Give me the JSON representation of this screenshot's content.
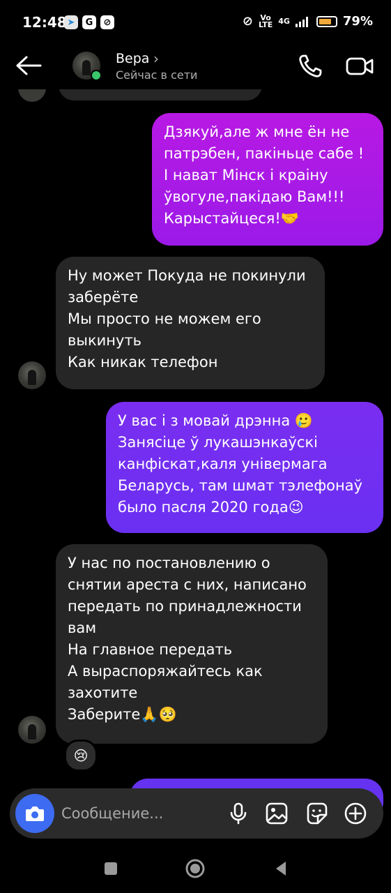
{
  "status_bar": {
    "time": "12:48",
    "network": "4G",
    "battery_percent": "79%",
    "battery_level": 0.79,
    "app_icons": [
      "telegram-icon",
      "google-icon",
      "link-icon"
    ]
  },
  "header": {
    "contact_name": "Вера",
    "chevron": "›",
    "contact_status": "Сейчас в сети",
    "online": true
  },
  "messages": [
    {
      "direction": "outgoing",
      "text": "Дзякуй,але ж мне ён не\nпатрэбен, пакіньце сабе !\nІ нават Мінск і краіну\nўвогуле,пакідаю Вам!!!\nКарыстайцеся!🤝"
    },
    {
      "direction": "incoming",
      "text": "Ну может Покуда не покинули\nзаберёте\nМы просто не можем его\nвыкинуть\nКак никак телефон"
    },
    {
      "direction": "outgoing",
      "text": "У вас і з мовай дрэнна 🥲\nЗанясіце ў лукашэнкаўскі\nканфіскат,каля універмага\nБеларусь, там шмат тэлефонаў\nбыло пасля 2020 года😉"
    },
    {
      "direction": "incoming",
      "text": "У нас по постановлению о\nснятии ареста с них, написано\nпередать по принадлежности\nвам\nНа главное передать\nА выраспоряжайтесь как\nзахотите\nЗаберите🙏🥺",
      "reaction": "😢"
    },
    {
      "direction": "outgoing",
      "text": ""
    }
  ],
  "composer": {
    "placeholder": "Сообщение..."
  },
  "colors": {
    "background": "#000000",
    "incoming_bubble": "#262626",
    "outgoing_bubble_pink": "#b819e3",
    "outgoing_bubble_violet": "#7a2df0",
    "camera_button": "#3d6bf2",
    "online": "#3ac66b",
    "battery": "#f2a93b"
  }
}
